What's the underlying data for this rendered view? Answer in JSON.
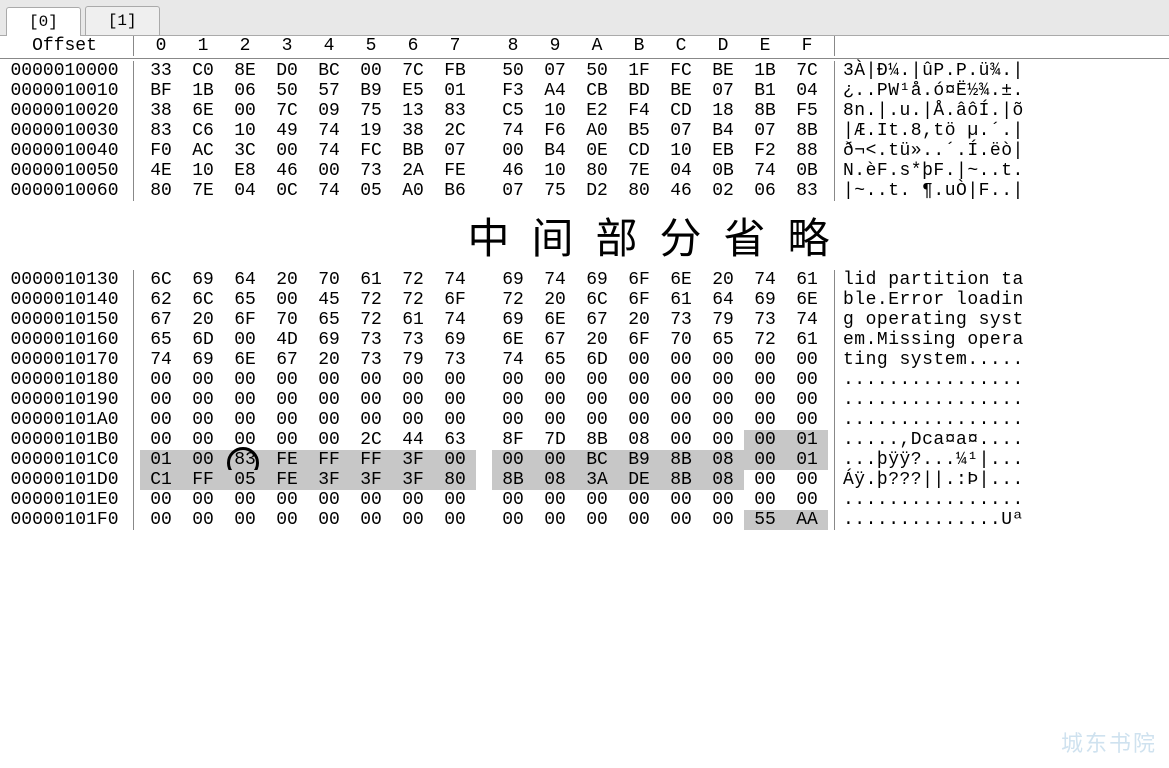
{
  "tabs": {
    "t0": "[0]",
    "t1": "[1]"
  },
  "header": {
    "offset_label": "Offset",
    "cols": [
      "0",
      "1",
      "2",
      "3",
      "4",
      "5",
      "6",
      "7",
      "8",
      "9",
      "A",
      "B",
      "C",
      "D",
      "E",
      "F"
    ]
  },
  "rows_top": [
    {
      "offset": "0000010000",
      "hex": [
        "33",
        "C0",
        "8E",
        "D0",
        "BC",
        "00",
        "7C",
        "FB",
        "50",
        "07",
        "50",
        "1F",
        "FC",
        "BE",
        "1B",
        "7C"
      ],
      "ascii": "3À|Ð¼.|ûP.P.ü¾.|"
    },
    {
      "offset": "0000010010",
      "hex": [
        "BF",
        "1B",
        "06",
        "50",
        "57",
        "B9",
        "E5",
        "01",
        "F3",
        "A4",
        "CB",
        "BD",
        "BE",
        "07",
        "B1",
        "04"
      ],
      "ascii": "¿..PW¹å.ó¤Ë½¾.±."
    },
    {
      "offset": "0000010020",
      "hex": [
        "38",
        "6E",
        "00",
        "7C",
        "09",
        "75",
        "13",
        "83",
        "C5",
        "10",
        "E2",
        "F4",
        "CD",
        "18",
        "8B",
        "F5"
      ],
      "ascii": "8n.|.u.|Å.âôÍ.|õ"
    },
    {
      "offset": "0000010030",
      "hex": [
        "83",
        "C6",
        "10",
        "49",
        "74",
        "19",
        "38",
        "2C",
        "74",
        "F6",
        "A0",
        "B5",
        "07",
        "B4",
        "07",
        "8B"
      ],
      "ascii": "|Æ.It.8,tö µ.´.|"
    },
    {
      "offset": "0000010040",
      "hex": [
        "F0",
        "AC",
        "3C",
        "00",
        "74",
        "FC",
        "BB",
        "07",
        "00",
        "B4",
        "0E",
        "CD",
        "10",
        "EB",
        "F2",
        "88"
      ],
      "ascii": "ð¬<.tü»..´.Í.ëò|"
    },
    {
      "offset": "0000010050",
      "hex": [
        "4E",
        "10",
        "E8",
        "46",
        "00",
        "73",
        "2A",
        "FE",
        "46",
        "10",
        "80",
        "7E",
        "04",
        "0B",
        "74",
        "0B"
      ],
      "ascii": "N.èF.s*þF.|~..t."
    },
    {
      "offset": "0000010060",
      "hex": [
        "80",
        "7E",
        "04",
        "0C",
        "74",
        "05",
        "A0",
        "B6",
        "07",
        "75",
        "D2",
        "80",
        "46",
        "02",
        "06",
        "83"
      ],
      "ascii": "|~..t. ¶.uÒ|F..|"
    }
  ],
  "omit_text": "中间部分省略",
  "rows_bottom": [
    {
      "offset": "0000010130",
      "hex": [
        "6C",
        "69",
        "64",
        "20",
        "70",
        "61",
        "72",
        "74",
        "69",
        "74",
        "69",
        "6F",
        "6E",
        "20",
        "74",
        "61"
      ],
      "ascii": "lid partition ta"
    },
    {
      "offset": "0000010140",
      "hex": [
        "62",
        "6C",
        "65",
        "00",
        "45",
        "72",
        "72",
        "6F",
        "72",
        "20",
        "6C",
        "6F",
        "61",
        "64",
        "69",
        "6E"
      ],
      "ascii": "ble.Error loadin"
    },
    {
      "offset": "0000010150",
      "hex": [
        "67",
        "20",
        "6F",
        "70",
        "65",
        "72",
        "61",
        "74",
        "69",
        "6E",
        "67",
        "20",
        "73",
        "79",
        "73",
        "74"
      ],
      "ascii": "g operating syst"
    },
    {
      "offset": "0000010160",
      "hex": [
        "65",
        "6D",
        "00",
        "4D",
        "69",
        "73",
        "73",
        "69",
        "6E",
        "67",
        "20",
        "6F",
        "70",
        "65",
        "72",
        "61"
      ],
      "ascii": "em.Missing opera"
    },
    {
      "offset": "0000010170",
      "hex": [
        "74",
        "69",
        "6E",
        "67",
        "20",
        "73",
        "79",
        "73",
        "74",
        "65",
        "6D",
        "00",
        "00",
        "00",
        "00",
        "00"
      ],
      "ascii": "ting system....."
    },
    {
      "offset": "0000010180",
      "hex": [
        "00",
        "00",
        "00",
        "00",
        "00",
        "00",
        "00",
        "00",
        "00",
        "00",
        "00",
        "00",
        "00",
        "00",
        "00",
        "00"
      ],
      "ascii": "................"
    },
    {
      "offset": "0000010190",
      "hex": [
        "00",
        "00",
        "00",
        "00",
        "00",
        "00",
        "00",
        "00",
        "00",
        "00",
        "00",
        "00",
        "00",
        "00",
        "00",
        "00"
      ],
      "ascii": "................"
    },
    {
      "offset": "00000101A0",
      "hex": [
        "00",
        "00",
        "00",
        "00",
        "00",
        "00",
        "00",
        "00",
        "00",
        "00",
        "00",
        "00",
        "00",
        "00",
        "00",
        "00"
      ],
      "ascii": "................"
    },
    {
      "offset": "00000101B0",
      "hex": [
        "00",
        "00",
        "00",
        "00",
        "00",
        "2C",
        "44",
        "63",
        "8F",
        "7D",
        "8B",
        "08",
        "00",
        "00",
        "00",
        "01"
      ],
      "ascii": ".....,Dca¤a¤...."
    },
    {
      "offset": "00000101C0",
      "hex": [
        "01",
        "00",
        "83",
        "FE",
        "FF",
        "FF",
        "3F",
        "00",
        "00",
        "00",
        "BC",
        "B9",
        "8B",
        "08",
        "00",
        "01"
      ],
      "ascii": "...þÿÿ?...¼¹|..."
    },
    {
      "offset": "00000101D0",
      "hex": [
        "C1",
        "FF",
        "05",
        "FE",
        "3F",
        "3F",
        "3F",
        "80",
        "8B",
        "08",
        "3A",
        "DE",
        "8B",
        "08",
        "00",
        "00"
      ],
      "ascii": "Áÿ.þ???||.:Þ|..."
    },
    {
      "offset": "00000101E0",
      "hex": [
        "00",
        "00",
        "00",
        "00",
        "00",
        "00",
        "00",
        "00",
        "00",
        "00",
        "00",
        "00",
        "00",
        "00",
        "00",
        "00"
      ],
      "ascii": "................"
    },
    {
      "offset": "00000101F0",
      "hex": [
        "00",
        "00",
        "00",
        "00",
        "00",
        "00",
        "00",
        "00",
        "00",
        "00",
        "00",
        "00",
        "00",
        "00",
        "55",
        "AA"
      ],
      "ascii": "..............Uª"
    }
  ],
  "highlights": {
    "00000101B0": [
      14,
      15
    ],
    "00000101C0": [
      0,
      1,
      2,
      3,
      4,
      5,
      6,
      7,
      8,
      9,
      10,
      11,
      12,
      13,
      14,
      15
    ],
    "00000101D0": [
      0,
      1,
      2,
      3,
      4,
      5,
      6,
      7,
      8,
      9,
      10,
      11,
      12,
      13
    ],
    "00000101F0": [
      14,
      15
    ]
  },
  "circle": {
    "offset": "00000101C0",
    "col": 2
  },
  "watermark": "城东书院"
}
